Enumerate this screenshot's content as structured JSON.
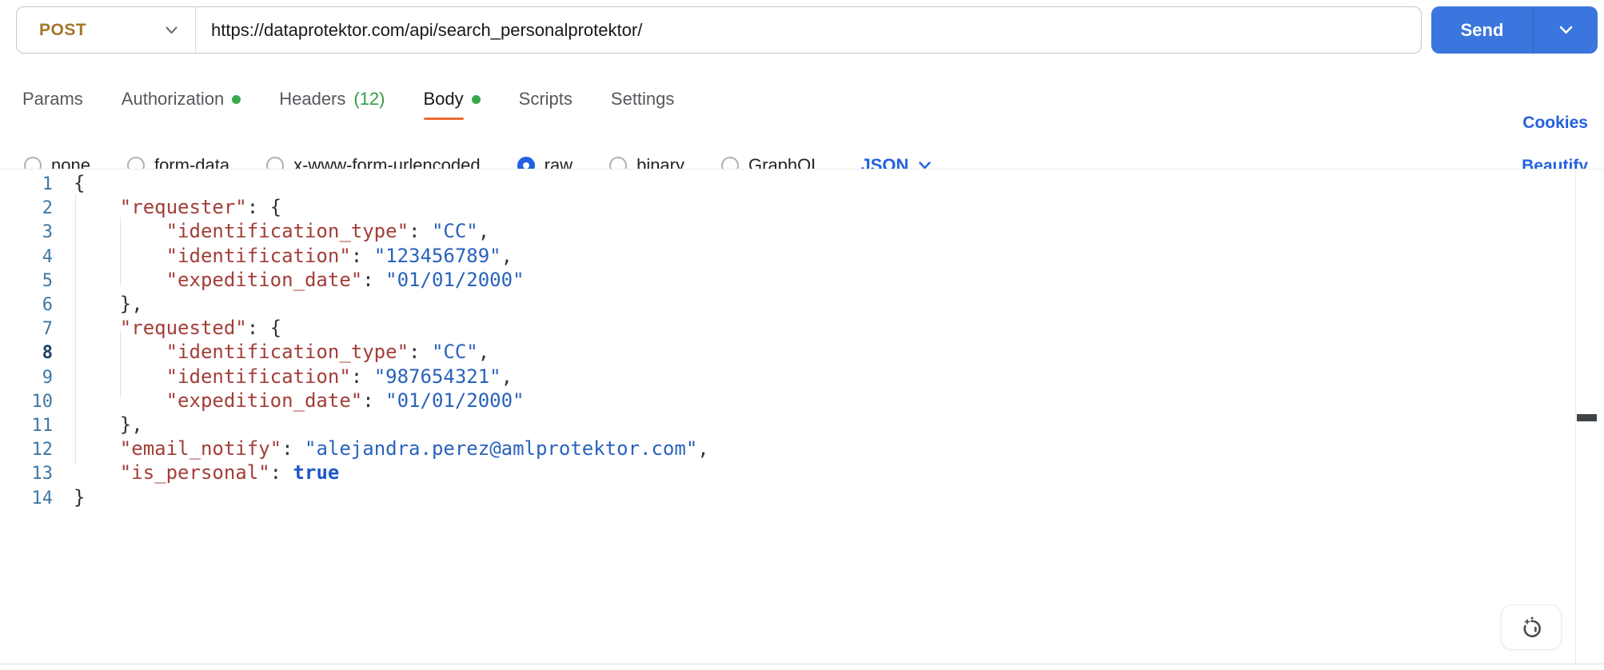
{
  "request_bar": {
    "method": "POST",
    "url": "https://dataprotektor.com/api/search_personalprotektor/",
    "send_label": "Send"
  },
  "tabs": {
    "items": [
      {
        "label": "Params"
      },
      {
        "label": "Authorization",
        "dot": true
      },
      {
        "label": "Headers",
        "badge": "(12)"
      },
      {
        "label": "Body",
        "dot": true,
        "active": true
      },
      {
        "label": "Scripts"
      },
      {
        "label": "Settings"
      }
    ],
    "cookies_label": "Cookies"
  },
  "body_options": {
    "options": [
      {
        "label": "none"
      },
      {
        "label": "form-data"
      },
      {
        "label": "x-www-form-urlencoded"
      },
      {
        "label": "raw",
        "selected": true
      },
      {
        "label": "binary"
      },
      {
        "label": "GraphQL"
      }
    ],
    "language": "JSON",
    "beautify_label": "Beautify"
  },
  "editor": {
    "lines": [
      {
        "num": "1",
        "tokens": [
          [
            "p",
            "{"
          ]
        ]
      },
      {
        "num": "2",
        "tokens": [
          [
            "p",
            "    "
          ],
          [
            "k",
            "\"requester\""
          ],
          [
            "p",
            ": {"
          ]
        ]
      },
      {
        "num": "3",
        "tokens": [
          [
            "p",
            "        "
          ],
          [
            "k",
            "\"identification_type\""
          ],
          [
            "p",
            ": "
          ],
          [
            "s",
            "\"CC\""
          ],
          [
            "p",
            ","
          ]
        ]
      },
      {
        "num": "4",
        "tokens": [
          [
            "p",
            "        "
          ],
          [
            "k",
            "\"identification\""
          ],
          [
            "p",
            ": "
          ],
          [
            "s",
            "\"123456789\""
          ],
          [
            "p",
            ","
          ]
        ]
      },
      {
        "num": "5",
        "tokens": [
          [
            "p",
            "        "
          ],
          [
            "k",
            "\"expedition_date\""
          ],
          [
            "p",
            ": "
          ],
          [
            "s",
            "\"01/01/2000\""
          ]
        ]
      },
      {
        "num": "6",
        "tokens": [
          [
            "p",
            "    },"
          ]
        ]
      },
      {
        "num": "7",
        "tokens": [
          [
            "p",
            "    "
          ],
          [
            "k",
            "\"requested\""
          ],
          [
            "p",
            ": {"
          ]
        ]
      },
      {
        "num": "8",
        "cursor": true,
        "tokens": [
          [
            "p",
            "        "
          ],
          [
            "k",
            "\"identification_type\""
          ],
          [
            "p",
            ": "
          ],
          [
            "s",
            "\"CC\""
          ],
          [
            "p",
            ","
          ]
        ]
      },
      {
        "num": "9",
        "tokens": [
          [
            "p",
            "        "
          ],
          [
            "k",
            "\"identification\""
          ],
          [
            "p",
            ": "
          ],
          [
            "s",
            "\"987654321\""
          ],
          [
            "p",
            ","
          ]
        ]
      },
      {
        "num": "10",
        "tokens": [
          [
            "p",
            "        "
          ],
          [
            "k",
            "\"expedition_date\""
          ],
          [
            "p",
            ": "
          ],
          [
            "s",
            "\"01/01/2000\""
          ]
        ]
      },
      {
        "num": "11",
        "tokens": [
          [
            "p",
            "    },"
          ]
        ]
      },
      {
        "num": "12",
        "tokens": [
          [
            "p",
            "    "
          ],
          [
            "k",
            "\"email_notify\""
          ],
          [
            "p",
            ": "
          ],
          [
            "s",
            "\"alejandra.perez@amlprotektor.com\""
          ],
          [
            "p",
            ","
          ]
        ]
      },
      {
        "num": "13",
        "tokens": [
          [
            "p",
            "    "
          ],
          [
            "k",
            "\"is_personal\""
          ],
          [
            "p",
            ": "
          ],
          [
            "b",
            "true"
          ]
        ]
      },
      {
        "num": "14",
        "tokens": [
          [
            "p",
            "}"
          ]
        ]
      }
    ]
  },
  "colors": {
    "method_post": "#A67728",
    "send_blue": "#3B76DE",
    "accent_blue": "#2361DF",
    "green_dot": "#37A94C",
    "badge_green": "#2F9E44",
    "tab_underline_orange": "#EF6C35",
    "code_key": "#A33E38",
    "code_string": "#2962BC",
    "code_bool": "#1E56C8",
    "line_number": "#3E77A4",
    "line_number_active": "#1B3F66"
  }
}
